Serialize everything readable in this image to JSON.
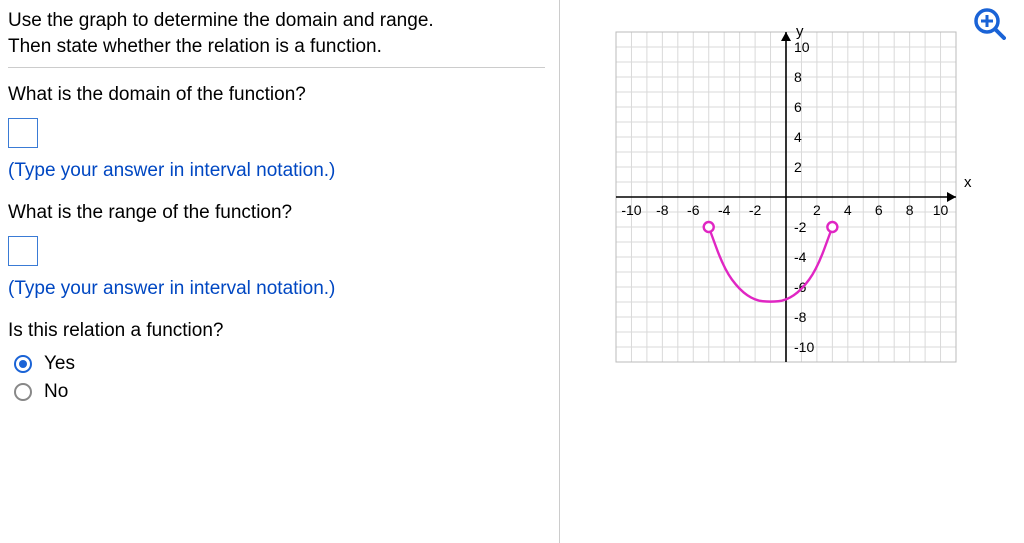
{
  "prompt": {
    "line1": "Use the graph to determine the domain and range.",
    "line2": "Then state whether the relation is a function."
  },
  "questions": {
    "domain": {
      "label": "What is the domain of the function?",
      "hint": "(Type your answer in interval notation.)",
      "value": ""
    },
    "range": {
      "label": "What is the range of the function?",
      "hint": "(Type your answer in interval notation.)",
      "value": ""
    },
    "isFunction": {
      "label": "Is this relation a function?",
      "options": {
        "yes": "Yes",
        "no": "No"
      },
      "selected": "yes"
    }
  },
  "chart_data": {
    "type": "line",
    "title": "",
    "xlabel": "x",
    "ylabel": "y",
    "xlim": [
      -11,
      11
    ],
    "ylim": [
      -11,
      11
    ],
    "xticks": [
      -10,
      -8,
      -6,
      -4,
      -2,
      2,
      4,
      6,
      8,
      10
    ],
    "yticks": [
      -10,
      -8,
      -6,
      -4,
      -2,
      2,
      4,
      6,
      8,
      10
    ],
    "grid": true,
    "series": [
      {
        "name": "curve",
        "color": "#e026c3",
        "endpoints": "open",
        "points": [
          {
            "x": -5,
            "y": -2
          },
          {
            "x": -4,
            "y": -4.8
          },
          {
            "x": -3,
            "y": -6.2
          },
          {
            "x": -2,
            "y": -6.9
          },
          {
            "x": -1,
            "y": -7
          },
          {
            "x": 0,
            "y": -6.9
          },
          {
            "x": 1,
            "y": -6.2
          },
          {
            "x": 2,
            "y": -4.8
          },
          {
            "x": 3,
            "y": -2
          }
        ]
      }
    ]
  }
}
